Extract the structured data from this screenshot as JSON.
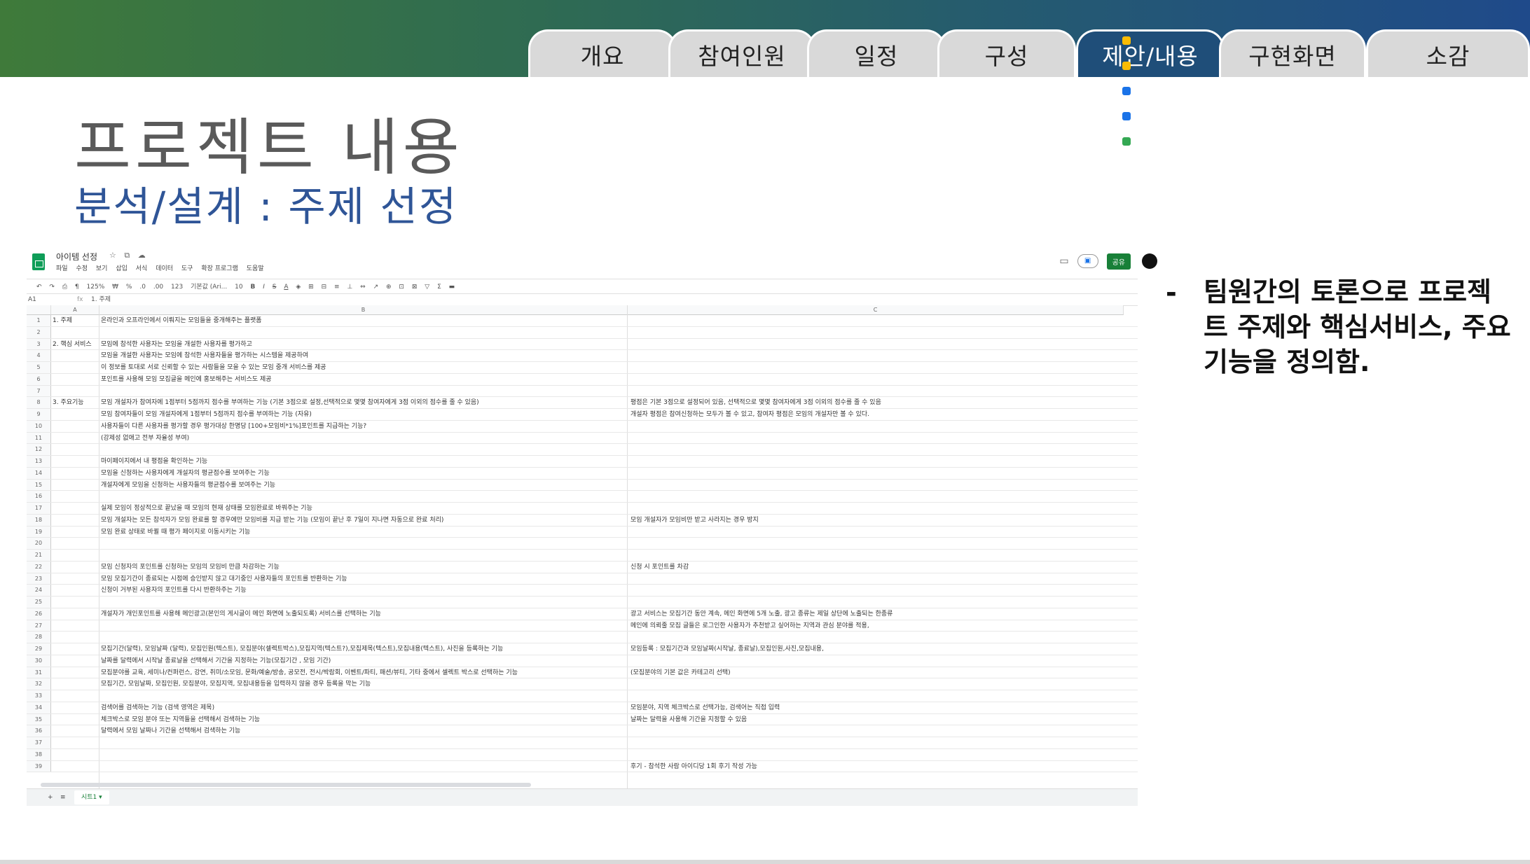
{
  "nav_tabs": [
    {
      "label": "개요",
      "active": false
    },
    {
      "label": "참여인원",
      "active": false
    },
    {
      "label": "일정",
      "active": false
    },
    {
      "label": "구성",
      "active": false
    },
    {
      "label": "제안/내용",
      "active": true
    },
    {
      "label": "구현화면",
      "active": false
    },
    {
      "label": "소감",
      "active": false
    }
  ],
  "slide": {
    "title": "프로젝트 내용",
    "subtitle": "분석/설계 : 주제 선정",
    "bullet_dash": "-",
    "bullet": "팀원간의 토론으로 프로젝트 주제와 핵심서비스, 주요기능을 정의함."
  },
  "colors": {
    "active_tab": "#1f4e79",
    "subtitle": "#2f5597",
    "share_button": "#188038"
  },
  "spreadsheet": {
    "doc_title": "아이템 선정",
    "title_icons": "☆ ⧉ ☁",
    "menus": [
      "파일",
      "수정",
      "보기",
      "삽입",
      "서식",
      "데이터",
      "도구",
      "확장 프로그램",
      "도움말"
    ],
    "share_label": "공유",
    "toolbar": [
      "↶",
      "↷",
      "⎙",
      "¶",
      "125%",
      "₩",
      "%",
      ".0",
      ".00",
      "123",
      "기본값 (Ari...",
      "10",
      "B",
      "I",
      "S",
      "A",
      "◈",
      "⊞",
      "⊟",
      "≡",
      "⊥",
      "⇔",
      "↗",
      "⊕",
      "⊡",
      "⊠",
      "▽",
      "Σ",
      "▬"
    ],
    "cell_ref": "A1",
    "fx": "fx",
    "formula_value": "1. 주제",
    "columns": [
      "A",
      "B",
      "C"
    ],
    "rows": [
      {
        "n": "1",
        "a": "1. 주제",
        "b": "온라인과 오프라인에서 이뤄지는 모임들을 중개해주는 플랫폼",
        "c": ""
      },
      {
        "n": "2",
        "a": "",
        "b": "",
        "c": ""
      },
      {
        "n": "3",
        "a": "2. 핵심 서비스",
        "b": "모임에 참석한 사용자는 모임을 개설한 사용자를 평가하고",
        "c": ""
      },
      {
        "n": "4",
        "a": "",
        "b": "모임을 개설한 사용자는 모임에 참석한 사용자들을 평가하는 시스템을 제공하여",
        "c": ""
      },
      {
        "n": "5",
        "a": "",
        "b": "이 정보를 토대로 서로 신뢰할 수 있는 사람들을 모을 수 있는 모임 중개 서비스를 제공",
        "c": ""
      },
      {
        "n": "6",
        "a": "",
        "b": "포인트를 사용해 모임 모집글을 메인에 홍보해주는 서비스도 제공",
        "c": ""
      },
      {
        "n": "7",
        "a": "",
        "b": "",
        "c": ""
      },
      {
        "n": "8",
        "a": "3. 주요기능",
        "b": "모임 개설자가 참여자에 1점부터 5점까지 점수를 부여하는 기능 (기본 3점으로 설정,선택적으로 몇몇 참여자에게 3점 이외의 점수를 줄 수 있음)",
        "c": "평점은 기본 3점으로 설정되어 있음, 선택적으로 몇몇 참여자에게 3점 이외의 점수를 줄 수 있음"
      },
      {
        "n": "9",
        "a": "",
        "b": "모임 참여자들이 모임 개설자에게 1점부터 5점까지 점수를 부여하는 기능 (자유)",
        "c": "개설자 평점은 참여신청하는 모두가 볼 수 있고, 참여자 평점은 모임의 개설자만 볼 수 있다."
      },
      {
        "n": "10",
        "a": "",
        "b": "사용자들이 다른 사용자를 평가할 경우 평가대상 한명당 [100+모임비*1%]포인트를 지급하는 기능?",
        "c": ""
      },
      {
        "n": "11",
        "a": "",
        "b": "(강제성 없애고 전부 자율성 부여)",
        "c": ""
      },
      {
        "n": "12",
        "a": "",
        "b": "",
        "c": ""
      },
      {
        "n": "13",
        "a": "",
        "b": "마이페이지에서 내 평점을 확인하는 기능",
        "c": ""
      },
      {
        "n": "14",
        "a": "",
        "b": "모임을 신청하는 사용자에게 개설자의 평균점수를 보여주는 기능",
        "c": ""
      },
      {
        "n": "15",
        "a": "",
        "b": "개설자에게 모임을 신청하는 사용자들의 평균점수를 보여주는 기능",
        "c": ""
      },
      {
        "n": "16",
        "a": "",
        "b": "",
        "c": ""
      },
      {
        "n": "17",
        "a": "",
        "b": "실제 모임이 정상적으로 끝났을 때 모임의 현재 상태를 모임완료로 바꿔주는 기능",
        "c": ""
      },
      {
        "n": "18",
        "a": "",
        "b": "모임 개설자는 모든 참석자가 모임 완료를 할 경우에만 모임비를 지급 받는 기능 (모임이 끝난 후 7일이 지나면 자동으로 완료 처리)",
        "c": "모임 개설자가 모임비만 받고 사라지는 경우 방지"
      },
      {
        "n": "19",
        "a": "",
        "b": "모임 완료 상태로 바뀔 때 평가 페이지로 이동시키는 기능",
        "c": ""
      },
      {
        "n": "20",
        "a": "",
        "b": "",
        "c": ""
      },
      {
        "n": "21",
        "a": "",
        "b": "",
        "c": ""
      },
      {
        "n": "22",
        "a": "",
        "b": "모임 신청자의 포인트를 신청하는 모임의 모임비 만큼 차감하는 기능",
        "c": "신청 시 포인트를 차감"
      },
      {
        "n": "23",
        "a": "",
        "b": "모임 모집기간이 종료되는 시점에 승인받지 않고 대기중인 사용자들의 포인트를 반환하는 기능",
        "c": ""
      },
      {
        "n": "24",
        "a": "",
        "b": "신청이 거부된 사용자의 포인트를 다시 반환하주는 기능",
        "c": ""
      },
      {
        "n": "25",
        "a": "",
        "b": "",
        "c": ""
      },
      {
        "n": "26",
        "a": "",
        "b": "개설자가 개인포인트를 사용해 메인광고(본인의 게시글이 메인 화면에 노출되도록) 서비스를 선택하는 기능",
        "c": "광고 서비스는 모집기간 동안 계속, 메인 화면에 5개 노출, 광고 종류는 제일 상단에 노출되는 한종류"
      },
      {
        "n": "27",
        "a": "",
        "b": "",
        "c": "메인에 의뢰줄 모집 글들은 로그인한 사용자가 추천받고 싶어하는 지역과 관심 분야를 적용,"
      },
      {
        "n": "28",
        "a": "",
        "b": "",
        "c": ""
      },
      {
        "n": "29",
        "a": "",
        "b": "모집기간(달력), 모임날짜 (달력), 모집인원(텍스트), 모집분야(셀렉트박스),모집지역(텍스트?),모집제목(텍스트),모집내용(텍스트), 사진을 등록하는 기능",
        "c": "모임등록 : 모집기간과 모임날짜(시작날, 종료날),모집인원,사진,모집내용,"
      },
      {
        "n": "30",
        "a": "",
        "b": "날짜를 달력에서 시작날 종료날을 선택해서 기간을 지정하는 기능(모집기간 , 모임 기간)",
        "c": ""
      },
      {
        "n": "31",
        "a": "",
        "b": "모집분야를 교육, 세미나/컨퍼런스, 강연, 취미/소모임, 문화/예술/방송, 공모전, 전시/박람회, 이벤트/파티, 패션/뷰티, 기타 중에서 셀렉트 박스로 선택하는 기능",
        "c": "(모집분야의 기본 값은 카테고리 선택)"
      },
      {
        "n": "32",
        "a": "",
        "b": "모집기간, 모임날짜, 모집인원, 모집분야, 모집지역, 모집내용등을 입력하지 않을 경우 등록을 막는 기능",
        "c": ""
      },
      {
        "n": "33",
        "a": "",
        "b": "",
        "c": ""
      },
      {
        "n": "34",
        "a": "",
        "b": "검색어를 검색하는 기능 (검색 영역은 제목)",
        "c": "모임분야, 지역 체크박스로 선택가능, 검색어는 직접 입력"
      },
      {
        "n": "35",
        "a": "",
        "b": "체크박스로 모임 분야 또는 지역들을 선택해서 검색하는 기능",
        "c": "날짜는 달력을 사용해 기간을 지정할 수 있음"
      },
      {
        "n": "36",
        "a": "",
        "b": "달력에서 모임 날짜나 기간을 선택해서 검색하는 기능",
        "c": ""
      },
      {
        "n": "37",
        "a": "",
        "b": "",
        "c": ""
      },
      {
        "n": "38",
        "a": "",
        "b": "",
        "c": ""
      },
      {
        "n": "39",
        "a": "",
        "b": "",
        "c": "후기 - 참석한 사람 아이디당 1회 후기 작성 가능"
      }
    ],
    "sheet_tab": "시트1 ▾",
    "add_sheet": "+",
    "all_sheets": "≡"
  }
}
